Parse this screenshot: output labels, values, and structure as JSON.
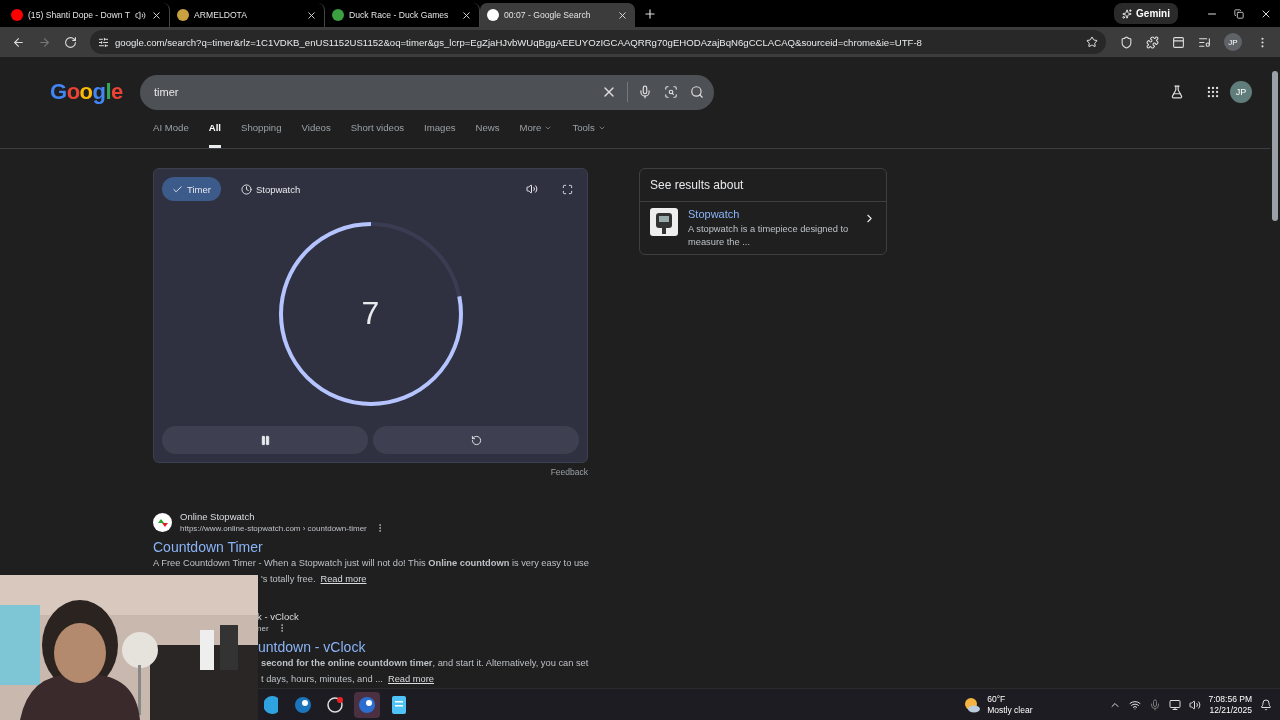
{
  "browser": {
    "tabs": [
      {
        "title": "(15) Shanti Dope - Down T",
        "selected": false,
        "audio": true
      },
      {
        "title": "ARMELDOTA",
        "selected": false,
        "audio": false
      },
      {
        "title": "Duck Race - Duck Games",
        "selected": false,
        "audio": false
      },
      {
        "title": "00:07 - Google Search",
        "selected": true,
        "audio": false
      }
    ],
    "gemini": "Gemini",
    "url": "google.com/search?q=timer&rlz=1C1VDKB_enUS1152US1152&oq=timer&gs_lcrp=EgZjaHJvbWUqBggAEEUYOzIGCAAQRRg70gEHODAzajBqN6gCCLACAQ&sourceid=chrome&ie=UTF-8",
    "profile": "JP"
  },
  "search": {
    "logo": "Google",
    "query": "timer",
    "avatar": "JP",
    "nav": [
      {
        "label": "AI Mode",
        "selected": false,
        "dropdown": false
      },
      {
        "label": "All",
        "selected": true,
        "dropdown": false
      },
      {
        "label": "Shopping",
        "selected": false,
        "dropdown": false
      },
      {
        "label": "Videos",
        "selected": false,
        "dropdown": false
      },
      {
        "label": "Short videos",
        "selected": false,
        "dropdown": false
      },
      {
        "label": "Images",
        "selected": false,
        "dropdown": false
      },
      {
        "label": "News",
        "selected": false,
        "dropdown": false
      },
      {
        "label": "More",
        "selected": false,
        "dropdown": true
      },
      {
        "label": "Tools",
        "selected": false,
        "dropdown": true
      }
    ]
  },
  "timer": {
    "modes": [
      {
        "label": "Timer",
        "selected": true
      },
      {
        "label": "Stopwatch",
        "selected": false
      }
    ],
    "value": "7",
    "feedback": "Feedback"
  },
  "see_results": {
    "heading": "See results about",
    "title": "Stopwatch",
    "description": "A stopwatch is a timepiece designed to measure the ..."
  },
  "results": [
    {
      "site": "Online Stopwatch",
      "url": "https://www.online-stopwatch.com › countdown-timer",
      "title": "Countdown Timer",
      "covered": false,
      "snippet": "A Free Countdown Timer - When a Stopwatch just will not do! This **Online countdown** is very easy to use",
      "covered_lines": [
        "'s totally free."
      ],
      "read_more": "Read more"
    },
    {
      "site": "k - vClock",
      "url": "ner",
      "title": "untdown - vClock",
      "covered": true,
      "covered_lines": [
        "**second for the online countdown timer**, and start it. Alternatively, you can set",
        "t days, hours, minutes, and ..."
      ],
      "read_more": "Read more"
    }
  ],
  "taskbar": {
    "temperature": "60°F",
    "weather": "Mostly clear",
    "time": "7:08:56 PM",
    "date": "12/21/2025"
  }
}
